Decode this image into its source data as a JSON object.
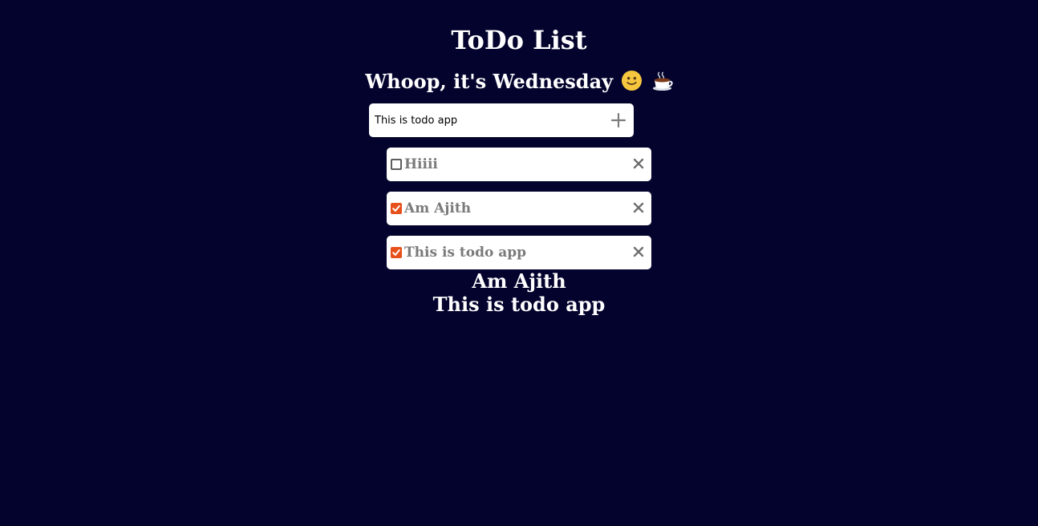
{
  "header": {
    "title": "ToDo List",
    "greeting": "Whoop, it's Wednesday"
  },
  "new_todo": {
    "value": "This is todo app",
    "add_icon": "plus-icon"
  },
  "todos": [
    {
      "text": "Hiiii",
      "checked": false
    },
    {
      "text": "Am Ajith",
      "checked": true
    },
    {
      "text": "This is todo app",
      "checked": true
    }
  ],
  "completed_list": [
    "Am Ajith",
    "This is todo app"
  ],
  "icons": {
    "greeting_emoji_1": "smiling-face-icon",
    "greeting_emoji_2": "hot-beverage-icon",
    "remove": "close-icon"
  },
  "colors": {
    "background": "#03032d",
    "checkbox_checked": "#e8501b",
    "item_text": "#7a7a7a"
  }
}
